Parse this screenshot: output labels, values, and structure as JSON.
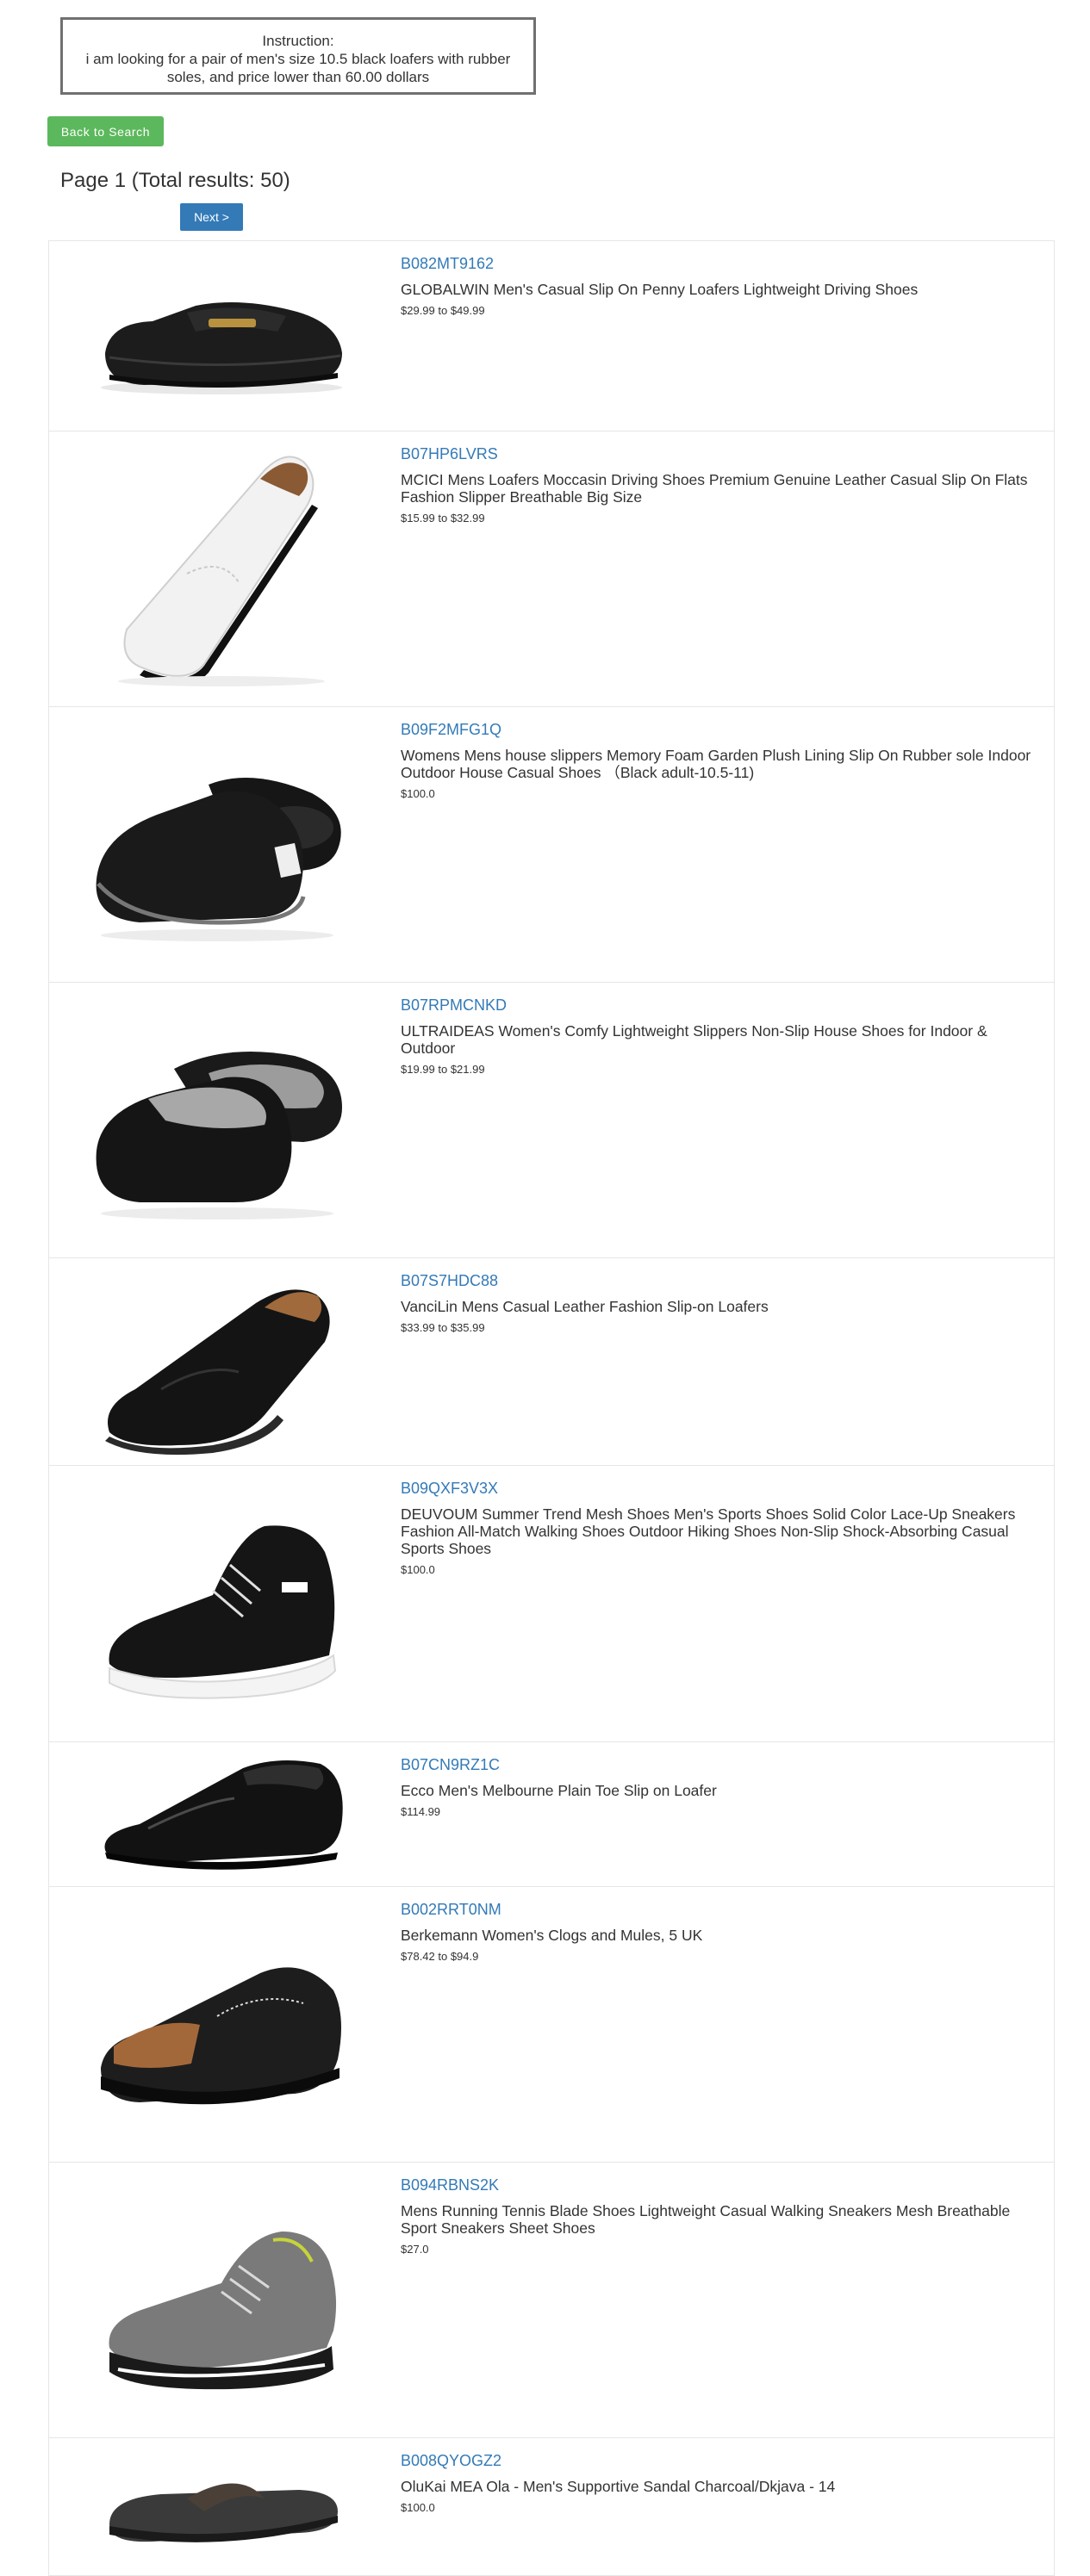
{
  "instruction": {
    "heading": "Instruction:",
    "text": "i am looking for a pair of men's size 10.5 black loafers with rubber soles, and price lower than 60.00 dollars"
  },
  "nav": {
    "back_label": "Back to Search",
    "page_title": "Page 1 (Total results: 50)",
    "next_label": "Next >"
  },
  "colors": {
    "back_button": "#5cb85c",
    "next_button": "#337ab7",
    "asin_link": "#337ab7"
  },
  "products": [
    {
      "asin": "B082MT9162",
      "title": "GLOBALWIN Men's Casual Slip On Penny Loafers Lightweight Driving Shoes",
      "price": "$29.99 to $49.99",
      "image": "black-penny-loafer"
    },
    {
      "asin": "B07HP6LVRS",
      "title": "MCICI Mens Loafers Moccasin Driving Shoes Premium Genuine Leather Casual Slip On Flats Fashion Slipper Breathable Big Size",
      "price": "$15.99 to $32.99",
      "image": "white-moccasin"
    },
    {
      "asin": "B09F2MFG1Q",
      "title": "Womens Mens house slippers Memory Foam Garden Plush Lining Slip On Rubber sole Indoor Outdoor House Casual Shoes （Black adult-10.5-11)",
      "price": "$100.0",
      "image": "black-slippers"
    },
    {
      "asin": "B07RPMCNKD",
      "title": "ULTRAIDEAS Women's Comfy Lightweight Slippers Non-Slip House Shoes for Indoor & Outdoor",
      "price": "$19.99 to $21.99",
      "image": "black-plush-slippers"
    },
    {
      "asin": "B07S7HDC88",
      "title": "VanciLin Mens Casual Leather Fashion Slip-on Loafers",
      "price": "$33.99 to $35.99",
      "image": "black-leather-loafer"
    },
    {
      "asin": "B09QXF3V3X",
      "title": "DEUVOUM Summer Trend Mesh Shoes Men's Sports Shoes Solid Color Lace-Up Sneakers Fashion All-Match Walking Shoes Outdoor Hiking Shoes Non-Slip Shock-Absorbing Casual Sports Shoes",
      "price": "$100.0",
      "image": "black-sneaker"
    },
    {
      "asin": "B07CN9RZ1C",
      "title": "Ecco Men's Melbourne Plain Toe Slip on Loafer",
      "price": "$114.99",
      "image": "black-dress-loafer"
    },
    {
      "asin": "B002RRT0NM",
      "title": "Berkemann Women's Clogs and Mules, 5 UK",
      "price": "$78.42 to $94.9",
      "image": "black-clog"
    },
    {
      "asin": "B094RBNS2K",
      "title": "Mens Running Tennis Blade Shoes Lightweight Casual Walking Sneakers Mesh Breathable Sport Sneakers Sheet Shoes",
      "price": "$27.0",
      "image": "gray-blade-sneaker"
    },
    {
      "asin": "B008QYOGZ2",
      "title": "OluKai MEA Ola - Men's Supportive Sandal Charcoal/Dkjava - 14",
      "price": "$100.0",
      "image": "charcoal-sandal"
    }
  ]
}
